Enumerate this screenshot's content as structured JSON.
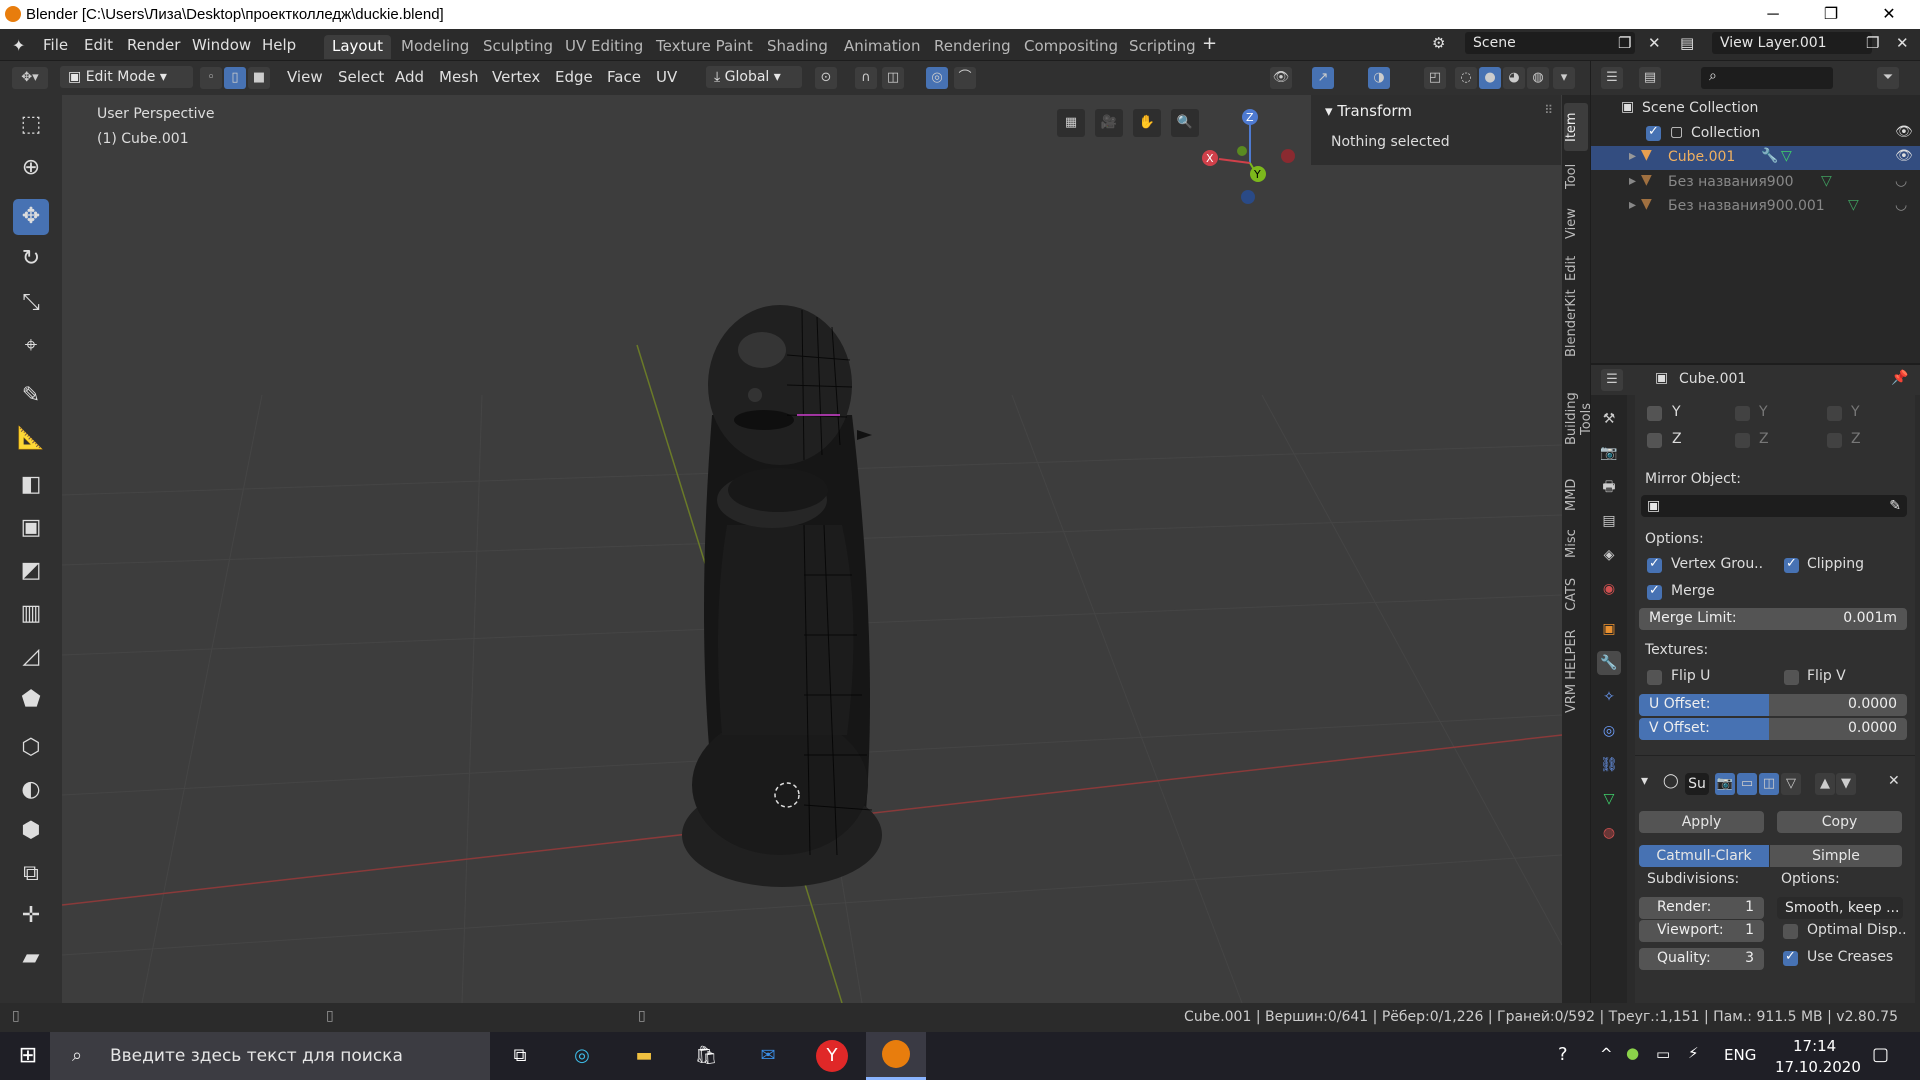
{
  "window": {
    "title": "Blender [C:\\Users\\Лиза\\Desktop\\проектколледж\\duckie.blend]"
  },
  "menu": [
    "File",
    "Edit",
    "Render",
    "Window",
    "Help"
  ],
  "workspaces": [
    "Layout",
    "Modeling",
    "Sculpting",
    "UV Editing",
    "Texture Paint",
    "Shading",
    "Animation",
    "Rendering",
    "Compositing",
    "Scripting"
  ],
  "scene": {
    "name": "Scene",
    "view_layer": "View Layer.001"
  },
  "header": {
    "mode": "Edit Mode",
    "menus": [
      "View",
      "Select",
      "Add",
      "Mesh",
      "Vertex",
      "Edge",
      "Face",
      "UV"
    ],
    "orientation": "Global"
  },
  "viewport": {
    "info_line1": "User Perspective",
    "info_line2": "(1) Cube.001",
    "gizmo": {
      "z": "Z",
      "x": "X",
      "y": "Y"
    }
  },
  "npanel": {
    "header": "Transform",
    "body": "Nothing selected",
    "tabs": [
      "Item",
      "Tool",
      "View",
      "Edit",
      "BlenderKit",
      "Building Tools",
      "MMD",
      "Misc",
      "CATS",
      "VRM HELPER"
    ]
  },
  "outliner": {
    "root": "Scene Collection",
    "collection": "Collection",
    "objects": [
      "Cube.001",
      "Без названия900",
      "Без названия900.001"
    ]
  },
  "properties": {
    "object_name": "Cube.001",
    "axis_labels": [
      "Y",
      "Z"
    ],
    "mirror_object_label": "Mirror Object:",
    "options_label": "Options:",
    "vertex_groups": "Vertex Grou..",
    "clipping": "Clipping",
    "merge": "Merge",
    "merge_limit_label": "Merge Limit:",
    "merge_limit": "0.001m",
    "textures_label": "Textures:",
    "flip_u": "Flip U",
    "flip_v": "Flip V",
    "u_offset_label": "U Offset:",
    "u_offset": "0.0000",
    "v_offset_label": "V Offset:",
    "v_offset": "0.0000",
    "subsurf": {
      "name": "Su",
      "apply": "Apply",
      "copy": "Copy",
      "catmull": "Catmull-Clark",
      "simple": "Simple",
      "subdivisions_label": "Subdivisions:",
      "options_label": "Options:",
      "render_label": "Render:",
      "render": "1",
      "viewport_label": "Viewport:",
      "viewport": "1",
      "quality_label": "Quality:",
      "quality": "3",
      "uv_smooth": "Smooth, keep ...",
      "optimal_display": "Optimal Disp..",
      "use_creases": "Use Creases"
    }
  },
  "status": {
    "stats": "Cube.001 | Вершин:0/641 | Рёбер:0/1,226 | Граней:0/592 | Треуг.:1,151 | Пам.: 911.5 MB | v2.80.75"
  },
  "taskbar": {
    "search_placeholder": "Введите здесь текст для поиска",
    "lang": "ENG",
    "time": "17:14",
    "date": "17.10.2020"
  }
}
